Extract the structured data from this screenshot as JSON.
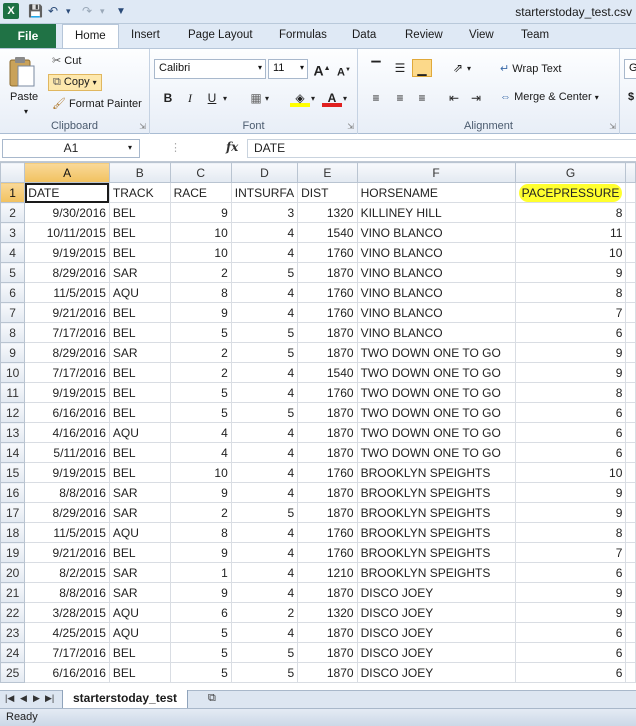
{
  "window": {
    "title": "starterstoday_test.csv",
    "app_icon": "X"
  },
  "tabs": [
    {
      "label": "File"
    },
    {
      "label": "Home"
    },
    {
      "label": "Insert"
    },
    {
      "label": "Page Layout"
    },
    {
      "label": "Formulas"
    },
    {
      "label": "Data"
    },
    {
      "label": "Review"
    },
    {
      "label": "View"
    },
    {
      "label": "Team"
    }
  ],
  "ribbon": {
    "clipboard": {
      "label": "Clipboard",
      "paste": "Paste",
      "cut": "Cut",
      "copy": "Copy",
      "format_painter": "Format Painter"
    },
    "font": {
      "label": "Font",
      "name": "Calibri",
      "size": "11",
      "bold": "B",
      "italic": "I",
      "underline": "U",
      "grow": "A",
      "shrink": "A",
      "font_color": "A"
    },
    "alignment": {
      "label": "Alignment",
      "wrap": "Wrap Text",
      "merge": "Merge & Center"
    },
    "number": {
      "format_partial": "G"
    }
  },
  "formula_bar": {
    "name_box": "A1",
    "fx": "fx",
    "content": "DATE"
  },
  "columns": [
    "A",
    "B",
    "C",
    "D",
    "E",
    "F",
    "G"
  ],
  "headers": [
    "DATE",
    "TRACK",
    "RACE",
    "INTSURFA",
    "DIST",
    "HORSENAME",
    "PACEPRESSURE"
  ],
  "rows": [
    [
      "9/30/2016",
      "BEL",
      "9",
      "3",
      "1320",
      "KILLINEY HILL",
      "8"
    ],
    [
      "10/11/2015",
      "BEL",
      "10",
      "4",
      "1540",
      "VINO BLANCO",
      "11"
    ],
    [
      "9/19/2015",
      "BEL",
      "10",
      "4",
      "1760",
      "VINO BLANCO",
      "10"
    ],
    [
      "8/29/2016",
      "SAR",
      "2",
      "5",
      "1870",
      "VINO BLANCO",
      "9"
    ],
    [
      "11/5/2015",
      "AQU",
      "8",
      "4",
      "1760",
      "VINO BLANCO",
      "8"
    ],
    [
      "9/21/2016",
      "BEL",
      "9",
      "4",
      "1760",
      "VINO BLANCO",
      "7"
    ],
    [
      "7/17/2016",
      "BEL",
      "5",
      "5",
      "1870",
      "VINO BLANCO",
      "6"
    ],
    [
      "8/29/2016",
      "SAR",
      "2",
      "5",
      "1870",
      "TWO DOWN ONE TO GO",
      "9"
    ],
    [
      "7/17/2016",
      "BEL",
      "2",
      "4",
      "1540",
      "TWO DOWN ONE TO GO",
      "9"
    ],
    [
      "9/19/2015",
      "BEL",
      "5",
      "4",
      "1760",
      "TWO DOWN ONE TO GO",
      "8"
    ],
    [
      "6/16/2016",
      "BEL",
      "5",
      "5",
      "1870",
      "TWO DOWN ONE TO GO",
      "6"
    ],
    [
      "4/16/2016",
      "AQU",
      "4",
      "4",
      "1870",
      "TWO DOWN ONE TO GO",
      "6"
    ],
    [
      "5/11/2016",
      "BEL",
      "4",
      "4",
      "1870",
      "TWO DOWN ONE TO GO",
      "6"
    ],
    [
      "9/19/2015",
      "BEL",
      "10",
      "4",
      "1760",
      "BROOKLYN SPEIGHTS",
      "10"
    ],
    [
      "8/8/2016",
      "SAR",
      "9",
      "4",
      "1870",
      "BROOKLYN SPEIGHTS",
      "9"
    ],
    [
      "8/29/2016",
      "SAR",
      "2",
      "5",
      "1870",
      "BROOKLYN SPEIGHTS",
      "9"
    ],
    [
      "11/5/2015",
      "AQU",
      "8",
      "4",
      "1760",
      "BROOKLYN SPEIGHTS",
      "8"
    ],
    [
      "9/21/2016",
      "BEL",
      "9",
      "4",
      "1760",
      "BROOKLYN SPEIGHTS",
      "7"
    ],
    [
      "8/2/2015",
      "SAR",
      "1",
      "4",
      "1210",
      "BROOKLYN SPEIGHTS",
      "6"
    ],
    [
      "8/8/2016",
      "SAR",
      "9",
      "4",
      "1870",
      "DISCO JOEY",
      "9"
    ],
    [
      "3/28/2015",
      "AQU",
      "6",
      "2",
      "1320",
      "DISCO JOEY",
      "9"
    ],
    [
      "4/25/2015",
      "AQU",
      "5",
      "4",
      "1870",
      "DISCO JOEY",
      "6"
    ],
    [
      "7/17/2016",
      "BEL",
      "5",
      "5",
      "1870",
      "DISCO JOEY",
      "6"
    ],
    [
      "6/16/2016",
      "BEL",
      "5",
      "5",
      "1870",
      "DISCO JOEY",
      "6"
    ]
  ],
  "sheet_tab": "starterstoday_test",
  "status": "Ready",
  "colors": {
    "file_tab": "#207245",
    "selection_header": "#f1c15f",
    "highlight": "#ffff2e"
  }
}
